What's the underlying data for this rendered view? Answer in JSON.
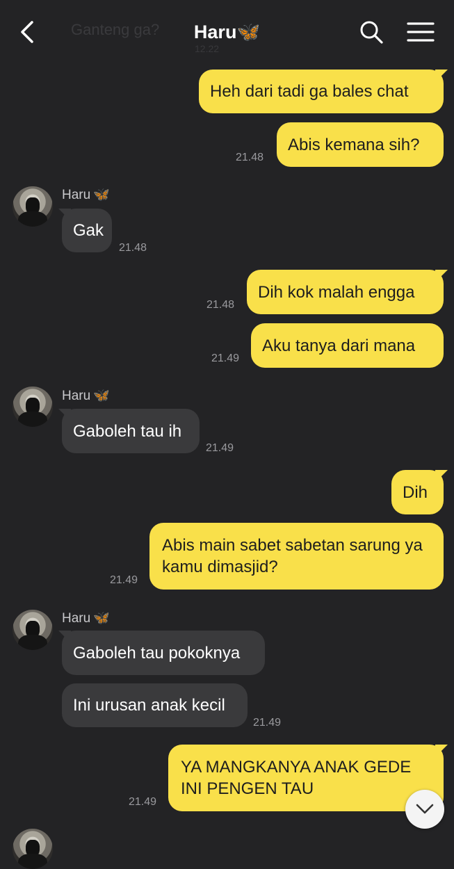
{
  "header": {
    "title": "Haru",
    "title_emoji": "🦋",
    "ghost_preview": "Ganteng ga?",
    "ghost_time": "12.22"
  },
  "contact": {
    "name": "Haru",
    "emoji": "🦋"
  },
  "messages": [
    {
      "from": "me",
      "text": "Heh dari tadi ga bales chat",
      "time": ""
    },
    {
      "from": "me",
      "text": "Abis kemana sih?",
      "time": "21.48"
    },
    {
      "from": "them",
      "text": "Gak",
      "time": "21.48"
    },
    {
      "from": "me",
      "text": "Dih kok malah engga",
      "time": "21.48"
    },
    {
      "from": "me",
      "text": "Aku tanya dari mana",
      "time": "21.49"
    },
    {
      "from": "them",
      "text": "Gaboleh tau ih",
      "time": "21.49"
    },
    {
      "from": "me",
      "text": "Dih",
      "time": ""
    },
    {
      "from": "me",
      "text": "Abis main sabet sabetan sarung ya kamu dimasjid?",
      "time": "21.49"
    },
    {
      "from": "them",
      "text": "Gaboleh tau pokoknya",
      "time": ""
    },
    {
      "from": "them",
      "text": "Ini urusan anak kecil",
      "time": "21.49"
    },
    {
      "from": "me",
      "text": "YA MANGKANYA ANAK GEDE INI PENGEN TAU",
      "time": "21.49"
    }
  ],
  "colors": {
    "background": "#232325",
    "outgoing_bubble": "#f9e04a",
    "incoming_bubble": "#3a3a3c"
  },
  "icons": {
    "back": "chevron-left-icon",
    "search": "search-icon",
    "menu": "hamburger-menu-icon",
    "scroll": "chevron-down-icon"
  }
}
